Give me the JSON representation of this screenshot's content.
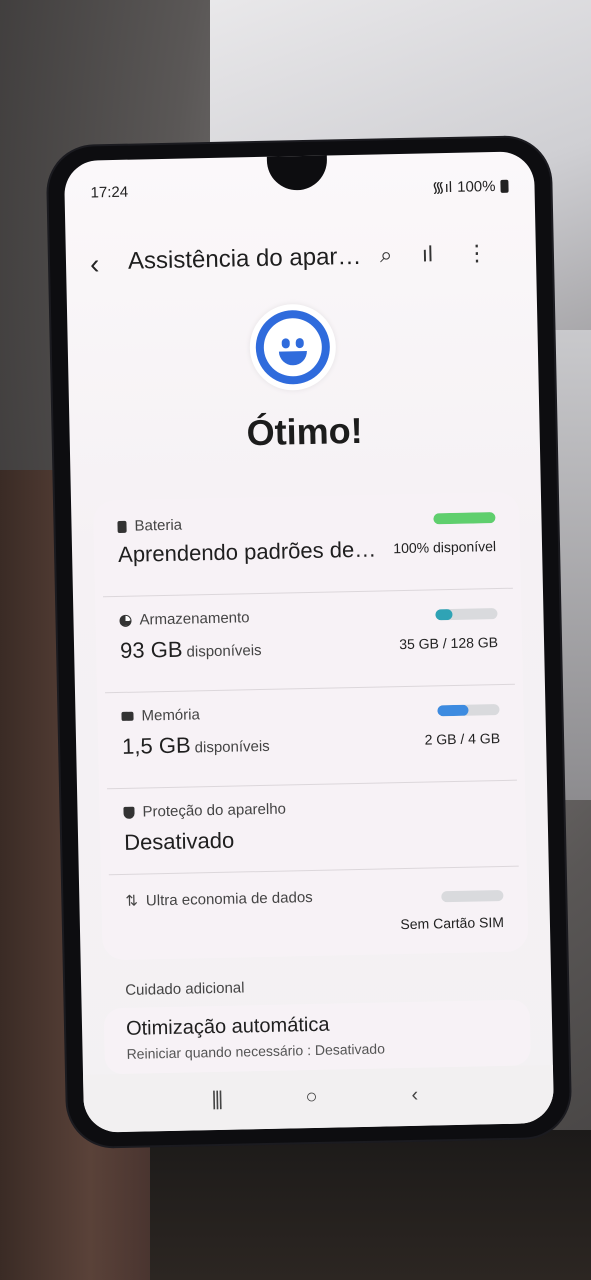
{
  "status_bar": {
    "time": "17:24",
    "signal": "᯾ıl",
    "battery": "100%"
  },
  "header": {
    "back": "‹",
    "title": "Assistência do aparelho",
    "search": "⌕",
    "stats": "ıl",
    "more": "⋮"
  },
  "hero": {
    "status": "Ótimo!"
  },
  "battery": {
    "label": "Bateria",
    "value": "Aprendendo padrões de uso",
    "right": "100% disponível",
    "fill": 1.0,
    "color": "#5fcf6d"
  },
  "storage": {
    "label": "Armazenamento",
    "value": "93 GB",
    "unit": "disponíveis",
    "right": "35 GB / 128 GB",
    "fill": 0.27,
    "color": "#2fa3b5"
  },
  "memory": {
    "label": "Memória",
    "value": "1,5 GB",
    "unit": "disponíveis",
    "right": "2 GB / 4 GB",
    "fill": 0.5,
    "color": "#3d8be0"
  },
  "protection": {
    "label": "Proteção do aparelho",
    "value": "Desativado"
  },
  "data_saver": {
    "label": "Ultra economia de dados",
    "right": "Sem Cartão SIM"
  },
  "extra": {
    "section": "Cuidado adicional",
    "title": "Otimização automática",
    "subtitle": "Reiniciar quando necessário : Desativado"
  },
  "nav": {
    "recents": "|||",
    "home": "○",
    "back": "‹"
  }
}
